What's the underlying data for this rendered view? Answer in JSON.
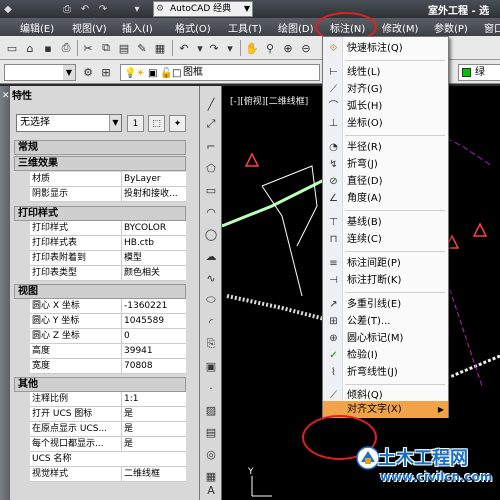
{
  "titlebar": {
    "workspace": "AutoCAD 经典",
    "app_title": "室外工程 - 选"
  },
  "menubar": {
    "items": [
      "编辑(E)",
      "视图(V)",
      "插入(I)",
      "格式(O)",
      "工具(T)",
      "绘图(D)",
      "标注(N)",
      "修改(M)",
      "参数(P)",
      "窗口"
    ]
  },
  "toolbar2": {
    "layer_name": "图框",
    "color_name": "绿"
  },
  "properties": {
    "title": "特性",
    "selection": "无选择",
    "sections": {
      "general": "常规",
      "3d_effect": "三维效果",
      "plot_style": "打印样式",
      "view": "视图",
      "misc": "其他"
    },
    "rows_3d": [
      {
        "k": "材质",
        "v": "ByLayer"
      },
      {
        "k": "阴影显示",
        "v": "投射和接收..."
      }
    ],
    "rows_plot": [
      {
        "k": "打印样式",
        "v": "BYCOLOR"
      },
      {
        "k": "打印样式表",
        "v": "HB.ctb"
      },
      {
        "k": "打印表附着到",
        "v": "模型"
      },
      {
        "k": "打印表类型",
        "v": "颜色相关"
      }
    ],
    "rows_view": [
      {
        "k": "圆心 X 坐标",
        "v": "-1360221"
      },
      {
        "k": "圆心 Y 坐标",
        "v": "1045589"
      },
      {
        "k": "圆心 Z 坐标",
        "v": "0"
      },
      {
        "k": "高度",
        "v": "39941"
      },
      {
        "k": "宽度",
        "v": "70808"
      }
    ],
    "rows_misc": [
      {
        "k": "注释比例",
        "v": "1:1"
      },
      {
        "k": "打开 UCS 图标",
        "v": "是"
      },
      {
        "k": "在原点显示 UCS...",
        "v": "是"
      },
      {
        "k": "每个视口都显示...",
        "v": "是"
      },
      {
        "k": "UCS 名称",
        "v": ""
      },
      {
        "k": "视觉样式",
        "v": "二维线框"
      }
    ]
  },
  "canvas": {
    "view_label": "[-][俯视][二维线框]"
  },
  "dim_menu": {
    "items": [
      {
        "label": "快速标注(Q)",
        "icon": "quick-dimension-icon",
        "glyph": "⟐"
      },
      {
        "label": "线性(L)",
        "icon": "linear-icon",
        "glyph": "⊢"
      },
      {
        "label": "对齐(G)",
        "icon": "aligned-icon",
        "glyph": "⟋"
      },
      {
        "label": "弧长(H)",
        "icon": "arc-length-icon",
        "glyph": "⌒"
      },
      {
        "label": "坐标(O)",
        "icon": "ordinate-icon",
        "glyph": "⊥"
      },
      {
        "label": "半径(R)",
        "icon": "radius-icon",
        "glyph": "◔"
      },
      {
        "label": "折弯(J)",
        "icon": "jogged-icon",
        "glyph": "↯"
      },
      {
        "label": "直径(D)",
        "icon": "diameter-icon",
        "glyph": "⊘"
      },
      {
        "label": "角度(A)",
        "icon": "angular-icon",
        "glyph": "∠"
      },
      {
        "label": "基线(B)",
        "icon": "baseline-icon",
        "glyph": "⊤"
      },
      {
        "label": "连续(C)",
        "icon": "continue-icon",
        "glyph": "⊓"
      },
      {
        "label": "标注间距(P)",
        "icon": "dim-space-icon",
        "glyph": "≡"
      },
      {
        "label": "标注打断(K)",
        "icon": "dim-break-icon",
        "glyph": "⊣"
      },
      {
        "label": "多重引线(E)",
        "icon": "multileader-icon",
        "glyph": "↗"
      },
      {
        "label": "公差(T)...",
        "icon": "tolerance-icon",
        "glyph": "⊞"
      },
      {
        "label": "圆心标记(M)",
        "icon": "center-mark-icon",
        "glyph": "⊕"
      },
      {
        "label": "检验(I)",
        "icon": "inspect-icon",
        "glyph": "✓"
      },
      {
        "label": "折弯线性(J)",
        "icon": "jogged-linear-icon",
        "glyph": "⌇"
      },
      {
        "label": "倾斜(Q)",
        "icon": "oblique-icon",
        "glyph": "⟋"
      },
      {
        "label": "对齐文字(X)",
        "icon": "align-text-icon",
        "glyph": ""
      }
    ]
  },
  "watermark": {
    "name": "土木工程网",
    "url": "www.civilcn.com"
  },
  "colors": {
    "menu_hover": "#f1a34a",
    "annotation_red": "#e02020",
    "layer_green": "#00c000"
  }
}
